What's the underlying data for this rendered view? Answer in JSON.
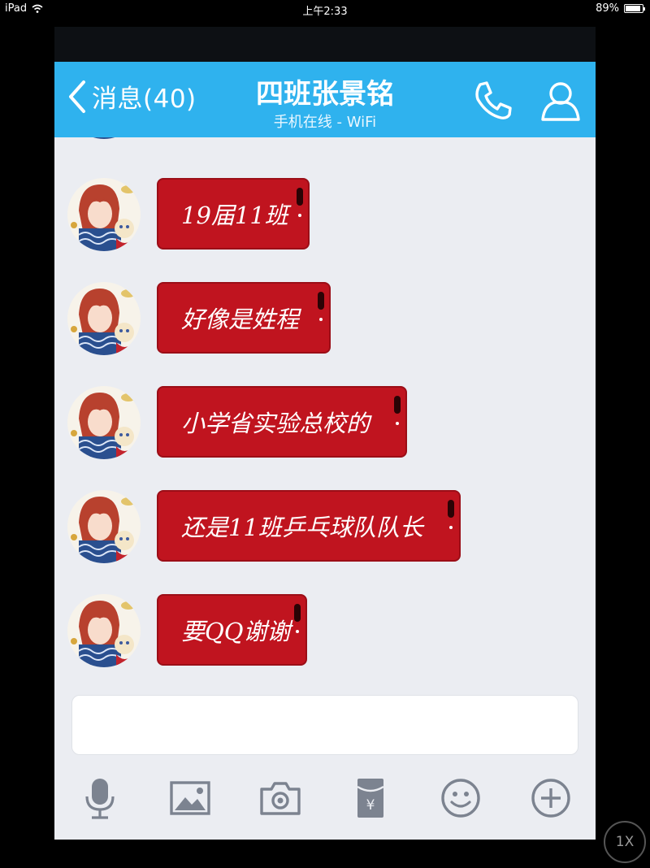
{
  "status_bar": {
    "device": "iPad",
    "time": "上午2:33",
    "battery": "89%",
    "battery_level": 0.89
  },
  "header": {
    "back_label": "消息(40)",
    "title": "四班张景铭",
    "subtitle": "手机在线 - WiFi",
    "icons": {
      "back": "chevron-left-icon",
      "phone": "phone-icon",
      "profile": "person-icon"
    }
  },
  "messages": [
    {
      "text": "19届11班"
    },
    {
      "text": "好像是姓程"
    },
    {
      "text": "小学省实验总校的"
    },
    {
      "text": "还是11班乒乓球队队长"
    },
    {
      "text": "要QQ谢谢"
    }
  ],
  "input": {
    "value": ""
  },
  "toolbar": [
    "microphone-icon",
    "image-icon",
    "camera-icon",
    "red-packet-icon",
    "emoji-icon",
    "plus-icon"
  ],
  "zoom_label": "1X",
  "colors": {
    "header": "#2fb2ee",
    "bubble": "#c0141f",
    "chat_bg": "#ebedf2",
    "icon": "#7c8390"
  }
}
